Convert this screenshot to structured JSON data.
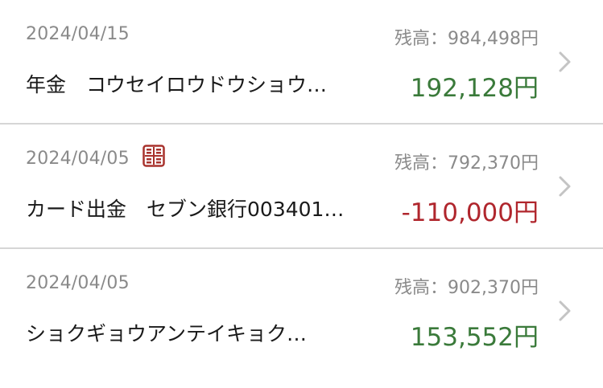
{
  "colors": {
    "positive": "#3a7a3a",
    "negative": "#b0262d",
    "muted": "#8a8a8a",
    "divider": "#d6d6d6",
    "badge": "#a8322d"
  },
  "transactions": [
    {
      "date": "2024/04/15",
      "balance": "残高：984,498円",
      "description": "年金　コウセイロウドウショウ…",
      "amount": "192,128円",
      "sign": "positive",
      "badge_icon": null
    },
    {
      "date": "2024/04/05",
      "balance": "残高：792,370円",
      "description": "カード出金　セブン銀行003401…",
      "amount": "-110,000円",
      "sign": "negative",
      "badge_icon": "atm-card-icon"
    },
    {
      "date": "2024/04/05",
      "balance": "残高：902,370円",
      "description": "ショクギョウアンテイキョク…",
      "amount": "153,552円",
      "sign": "positive",
      "badge_icon": null
    }
  ]
}
